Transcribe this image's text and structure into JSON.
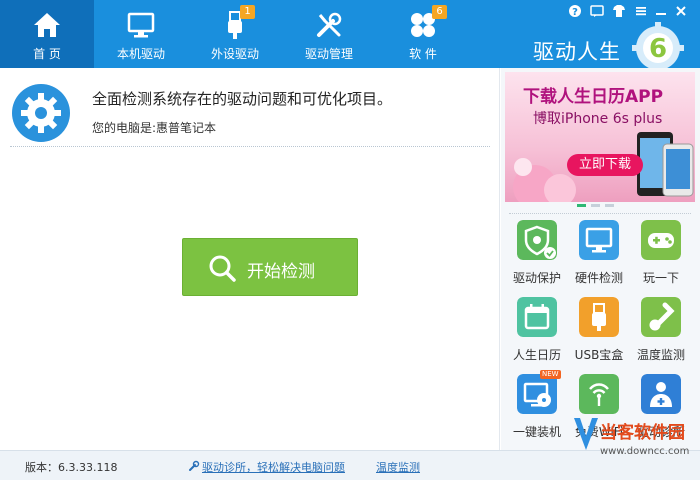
{
  "nav": {
    "tabs": [
      {
        "label": "首 页",
        "icon": "home-icon",
        "active": true
      },
      {
        "label": "本机驱动",
        "icon": "monitor-icon"
      },
      {
        "label": "外设驱动",
        "icon": "usb-icon",
        "badge": "1"
      },
      {
        "label": "驱动管理",
        "icon": "tools-icon"
      },
      {
        "label": "软 件",
        "icon": "apps-icon",
        "badge": "6"
      }
    ],
    "brand": "驱动人生",
    "logo_digit": "6"
  },
  "window_controls": [
    "help-icon",
    "message-icon",
    "skin-icon",
    "menu-icon",
    "minimize-icon",
    "close-icon"
  ],
  "main": {
    "title": "全面检测系统存在的驱动问题和可优化项目。",
    "subtitle": "您的电脑是:惠普笔记本",
    "start_button": "开始检测"
  },
  "ad": {
    "title": "下载人生日历APP",
    "subtitle": "博取iPhone 6s plus",
    "button": "立即下载"
  },
  "tools": [
    {
      "label": "驱动保护",
      "icon": "shield-icon",
      "color": "#5cb85c"
    },
    {
      "label": "硬件检测",
      "icon": "monitor-check-icon",
      "color": "#3aa0e6"
    },
    {
      "label": "玩一下",
      "icon": "gamepad-icon",
      "color": "#7ec04a"
    },
    {
      "label": "人生日历",
      "icon": "calendar-icon",
      "color": "#4fc3a1"
    },
    {
      "label": "USB宝盒",
      "icon": "usb-box-icon",
      "color": "#f2a02b"
    },
    {
      "label": "温度监测",
      "icon": "thermometer-icon",
      "color": "#7ec04a"
    },
    {
      "label": "一键装机",
      "icon": "disc-icon",
      "color": "#2f8fe0",
      "badge": "NEW"
    },
    {
      "label": "免费WiFi",
      "icon": "wifi-icon",
      "color": "#5cb85c"
    },
    {
      "label": "驱动诊所",
      "icon": "doctor-icon",
      "color": "#2f7fd6"
    }
  ],
  "footer": {
    "version": "版本：6.3.33.118",
    "link1": "驱动诊所，轻松解决电脑问题",
    "link2": "温度监测"
  },
  "watermark": {
    "text": "当客软件园",
    "url": "www.downcc.com"
  },
  "colors": {
    "topbar": "#1a8fdd",
    "active_tab": "#0f6fba",
    "start_button": "#7cc241",
    "badge": "#f5a623"
  }
}
